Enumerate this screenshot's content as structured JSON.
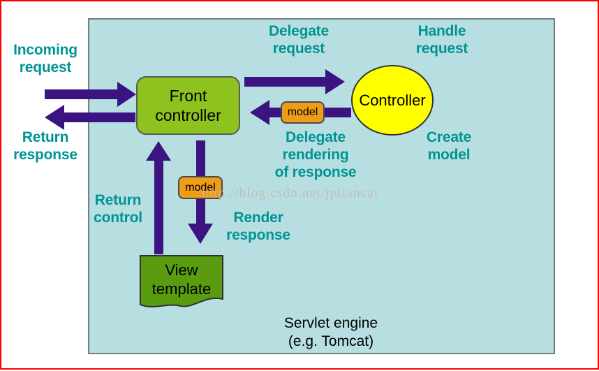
{
  "figure": {
    "title": "MVC front controller request flow inside a servlet engine",
    "colors": {
      "panel_background": "#b7dfe2",
      "panel_border": "#6e7f84",
      "image_border": "#ff0000",
      "label_teal": "#009494",
      "arrow_purple": "#3b1482",
      "front_controller_green": "#8dc21f",
      "view_template_green": "#5a9c10",
      "controller_yellow": "#ffff00",
      "model_orange": "#ee9d18",
      "watermark": "#c9b3b0"
    }
  },
  "panel": {
    "name": "Servlet engine",
    "caption": "Servlet engine\n(e.g. Tomcat)"
  },
  "nodes": {
    "front_controller": {
      "label": "Front\ncontroller"
    },
    "controller": {
      "label": "Controller"
    },
    "view_template": {
      "label": "View\ntemplate"
    },
    "model_right": {
      "label": "model"
    },
    "model_down": {
      "label": "model"
    }
  },
  "labels": {
    "incoming_request": "Incoming\nrequest",
    "return_response": "Return\nresponse",
    "delegate_request": "Delegate\nrequest",
    "handle_request": "Handle\nrequest",
    "delegate_rendering": "Delegate\nrendering\nof response",
    "create_model": "Create\nmodel",
    "return_control": "Return\ncontrol",
    "render_response": "Render\nresponse"
  },
  "watermark": {
    "text": "http://blog.csdn.net/jptiancai"
  }
}
